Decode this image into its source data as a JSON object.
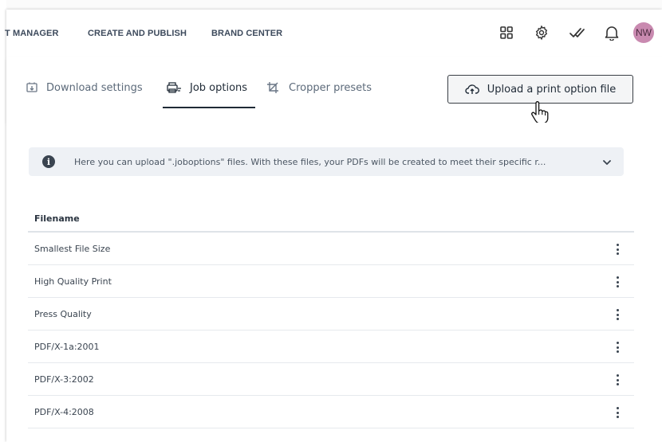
{
  "topnav": {
    "items": [
      "T MANAGER",
      "CREATE AND PUBLISH",
      "BRAND CENTER"
    ],
    "icons": [
      "apps-grid-icon",
      "gear-icon",
      "double-check-icon",
      "bell-icon"
    ],
    "avatar_initials": "NW"
  },
  "tabs": {
    "download_settings": "Download settings",
    "job_options": "Job options",
    "cropper_presets": "Cropper presets",
    "active": "Job options"
  },
  "upload_button_label": "Upload a print option file",
  "info": {
    "text": "Here you can upload \".joboptions\" files. With these files, your PDFs will be created to meet their specific r..."
  },
  "table": {
    "header": "Filename",
    "rows": [
      "Smallest File Size",
      "High Quality Print",
      "Press Quality",
      "PDF/X-1a:2001",
      "PDF/X-3:2002",
      "PDF/X-4:2008"
    ]
  },
  "colors": {
    "active_tab": "#1f2a36",
    "avatar_bg": "#c98ab0",
    "info_bg": "#eef1f5"
  }
}
